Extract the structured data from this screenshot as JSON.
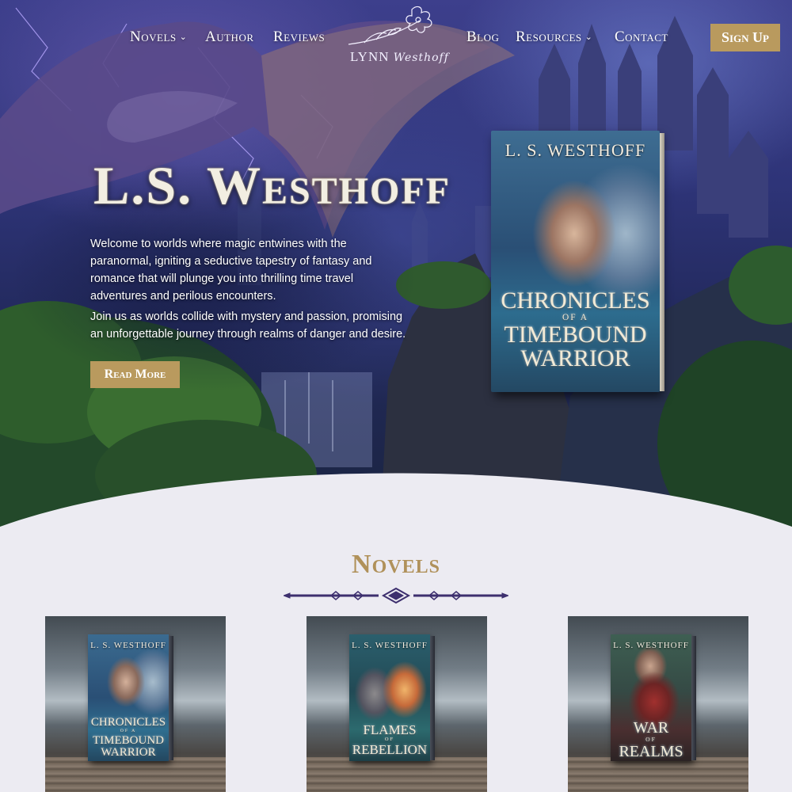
{
  "nav": {
    "items": [
      {
        "label": "Novels",
        "has_dropdown": true
      },
      {
        "label": "Author",
        "has_dropdown": false
      },
      {
        "label": "Reviews",
        "has_dropdown": false
      },
      {
        "label": "Blog",
        "has_dropdown": false
      },
      {
        "label": "Resources",
        "has_dropdown": true
      },
      {
        "label": "Contact",
        "has_dropdown": false
      }
    ],
    "logo": {
      "main": "LYNN",
      "script": "Westhoff"
    },
    "signup_label": "Sign Up",
    "dropdown_icon": "chevron-down-icon"
  },
  "hero": {
    "title": "L.S. Westhoff",
    "paragraph1": "Welcome to worlds where magic entwines with the paranormal, igniting a seductive tapestry of fantasy and romance that will plunge you into thrilling time travel adventures and perilous encounters.",
    "paragraph2": "Join us as worlds collide with mystery and passion, promising an unforgettable journey through realms of danger and desire.",
    "read_more_label": "Read More",
    "featured_book": {
      "author": "L. S. WESTHOFF",
      "title_line1": "CHRONICLES",
      "title_sub": "OF A",
      "title_line2": "TIMEBOUND",
      "title_line3": "WARRIOR"
    }
  },
  "novels": {
    "heading": "Novels",
    "books": [
      {
        "author": "L. S. WESTHOFF",
        "title_line1": "CHRONICLES",
        "title_sub": "OF A",
        "title_line2": "TIMEBOUND",
        "title_line3": "WARRIOR"
      },
      {
        "author": "L. S. WESTHOFF",
        "title_line1": "FLAMES",
        "title_sub": "OF",
        "title_line2": "REBELLION",
        "title_line3": ""
      },
      {
        "author": "L. S. WESTHOFF",
        "title_line1": "WAR",
        "title_sub": "OF",
        "title_line2": "REALMS",
        "title_line3": ""
      }
    ]
  },
  "colors": {
    "gold_accent": "#b99a5e",
    "heading_gold": "#b0915a",
    "divider_navy": "#3d2f6e",
    "section_bg": "#ecebf2"
  }
}
